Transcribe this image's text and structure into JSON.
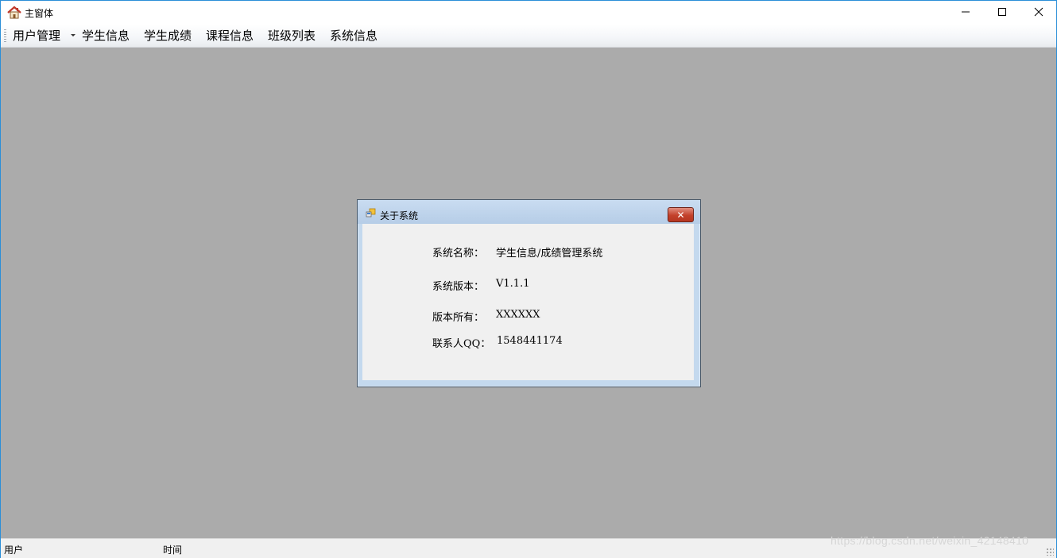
{
  "window": {
    "title": "主窗体",
    "min_icon": "minimize-icon",
    "max_icon": "maximize-icon",
    "close_icon": "close-icon",
    "accent": "#2b8fd8"
  },
  "menu": {
    "items": [
      "用户管理",
      "学生信息",
      "学生成绩",
      "课程信息",
      "班级列表",
      "系统信息"
    ]
  },
  "dialog": {
    "title": "关于系统",
    "close_label": "✕",
    "fields": [
      {
        "label": "系统名称：",
        "value": "学生信息/成绩管理系统"
      },
      {
        "label": "系统版本：",
        "value": "V1.1.1"
      },
      {
        "label": "版本所有：",
        "value": "XXXXXX"
      },
      {
        "label": "联系人QQ：",
        "value": "1548441174"
      }
    ]
  },
  "status": {
    "user_label": "用户",
    "time_label": "时间"
  },
  "watermark": "https://blog.csdn.net/weixin_42148410",
  "colors": {
    "mdi_background": "#ababab",
    "dialog_close": "#c3412b"
  }
}
